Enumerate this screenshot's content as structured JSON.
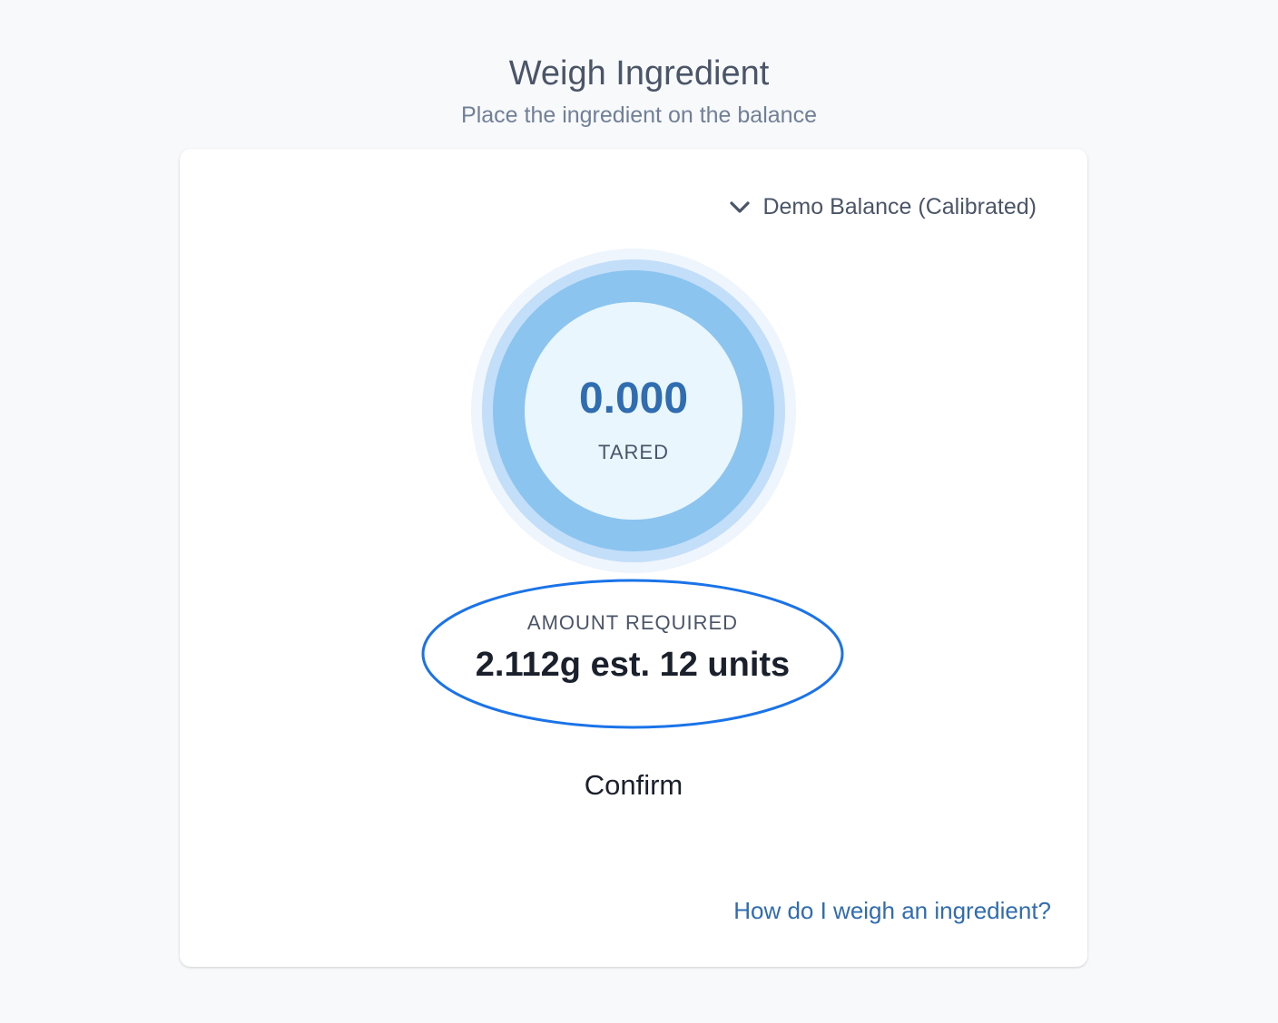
{
  "header": {
    "title": "Weigh Ingredient",
    "subtitle": "Place the ingredient on the balance"
  },
  "balance_selector": {
    "label": "Demo Balance (Calibrated)",
    "icon": "chevron-down-icon"
  },
  "scale": {
    "reading": "0.000",
    "status": "TARED"
  },
  "amount": {
    "label": "AMOUNT REQUIRED",
    "value": "2.112g est. 12 units"
  },
  "actions": {
    "confirm_label": "Confirm"
  },
  "help": {
    "link_text": "How do I weigh an ingredient?"
  },
  "colors": {
    "accent": "#2f6cb0",
    "ring": "#8cc4f0",
    "highlight": "#1a73e8"
  }
}
